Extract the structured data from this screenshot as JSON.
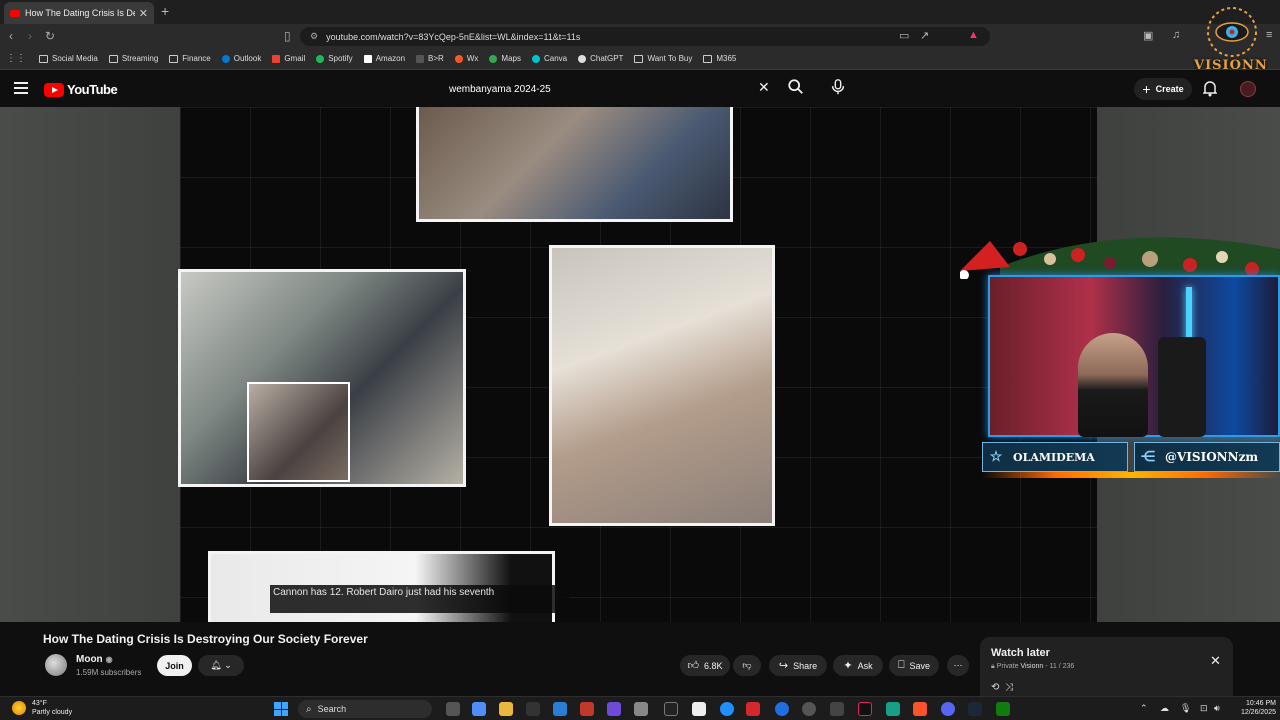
{
  "browser": {
    "tab_title": "How The Dating Crisis Is Destroying",
    "url": "youtube.com/watch?v=83YcQep-5nE&list=WL&index=11&t=11s",
    "bookmarks": [
      {
        "label": "Social Media",
        "icon": "folder-icon"
      },
      {
        "label": "Streaming",
        "icon": "folder-icon"
      },
      {
        "label": "Finance",
        "icon": "folder-icon"
      },
      {
        "label": "Outlook",
        "icon": "outlook-icon",
        "color": "#0078d4"
      },
      {
        "label": "Gmail",
        "icon": "gmail-icon",
        "color": "#ea4335"
      },
      {
        "label": "Spotify",
        "icon": "spotify-icon",
        "color": "#1db954"
      },
      {
        "label": "Amazon",
        "icon": "amazon-icon",
        "color": "#ffffff"
      },
      {
        "label": "B>R",
        "icon": "b-icon",
        "color": "#222222"
      },
      {
        "label": "Wx",
        "icon": "weather-icon",
        "color": "#ff5722"
      },
      {
        "label": "Maps",
        "icon": "maps-icon",
        "color": "#34a853"
      },
      {
        "label": "Canva",
        "icon": "canva-icon",
        "color": "#00c4cc"
      },
      {
        "label": "ChatGPT",
        "icon": "chatgpt-icon",
        "color": "#dddddd"
      },
      {
        "label": "Want To Buy",
        "icon": "folder-icon"
      },
      {
        "label": "M365",
        "icon": "folder-icon"
      }
    ]
  },
  "youtube": {
    "logo_text": "YouTube",
    "search_value": "wembanyama 2024-25",
    "create_label": "Create"
  },
  "video": {
    "caption": "Cannon has 12. Robert Dairo just had his seventh",
    "overlay_tag_1": "OLAMIDEMA",
    "overlay_tag_2": "@VISIONNzm",
    "watermark_text": "VISIONN"
  },
  "details": {
    "title": "How The Dating Crisis Is Destroying Our Society Forever",
    "channel": "Moon",
    "subscribers": "1.59M subscribers",
    "join_label": "Join",
    "like_count": "6.8K",
    "share_label": "Share",
    "ask_label": "Ask",
    "save_label": "Save"
  },
  "watch_later": {
    "title": "Watch later",
    "privacy": "Private",
    "owner": "Visionn",
    "position": "11 / 236"
  },
  "taskbar": {
    "temperature": "43°F",
    "condition": "Partly cloudy",
    "search_label": "Search",
    "time": "10:46 PM",
    "date": "12/26/2025"
  },
  "colors": {
    "accent_red": "#ff0000",
    "background": "#0f0f0f",
    "chip": "#272727"
  }
}
